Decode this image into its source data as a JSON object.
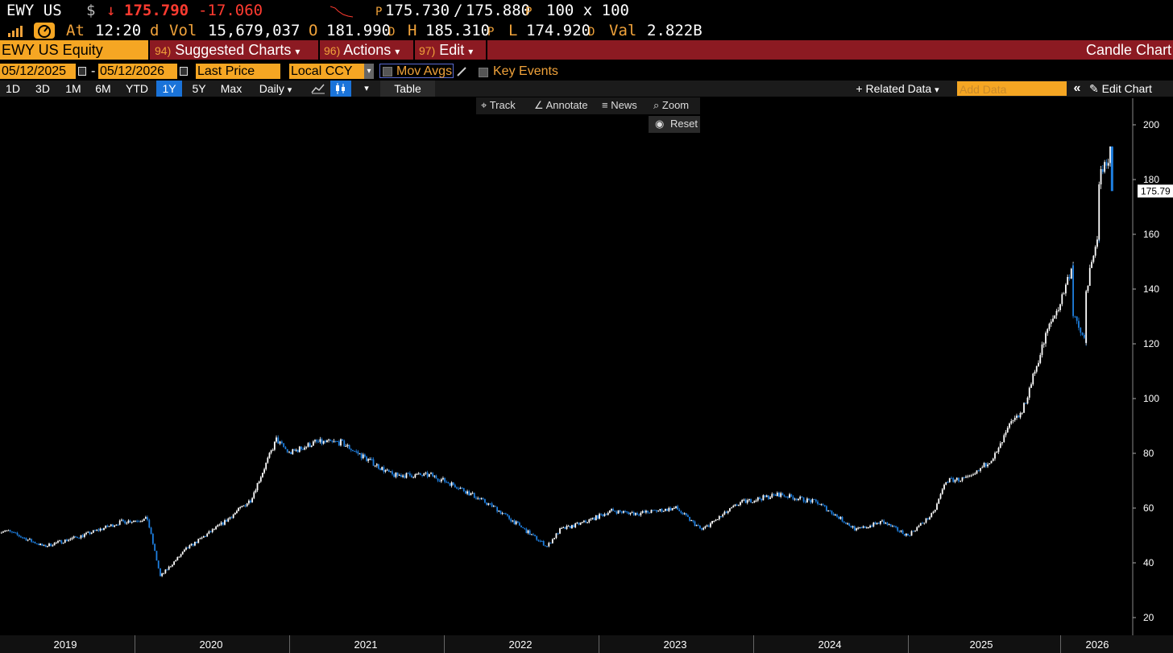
{
  "quote": {
    "ticker": "EWY US",
    "currency_symbol": "$",
    "arrow": "↓",
    "last": "175.790",
    "change": "-17.060",
    "bid_prefix": "P",
    "bid": "175.730",
    "slash": "/",
    "ask": "175.880",
    "ask_suffix": "P",
    "size": "100 x 100",
    "at_label": "At",
    "time": "12:20",
    "time_suffix": "d",
    "vol_label": "Vol",
    "vol": "15,679,037",
    "open_label": "O",
    "open": "181.990",
    "open_suffix": "D",
    "high_label": "H",
    "high": "185.310",
    "high_suffix": "P",
    "low_label": "L",
    "low": "174.920",
    "low_suffix": "D",
    "val_label": "Val",
    "val": "2.822B"
  },
  "menubar": {
    "security": "EWY US Equity",
    "suggested_num": "94)",
    "suggested": "Suggested Charts",
    "actions_num": "96)",
    "actions": "Actions",
    "edit_num": "97)",
    "edit": "Edit",
    "caret": "▾",
    "title": "Candle Chart"
  },
  "controls": {
    "start_date": "05/12/2025",
    "dash": "-",
    "end_date": "05/12/2026",
    "field": "Last Price",
    "currency": "Local CCY",
    "mov_avgs": "Mov Avgs",
    "key_events": "Key Events"
  },
  "periods": [
    "1D",
    "3D",
    "1M",
    "6M",
    "YTD",
    "1Y",
    "5Y",
    "Max"
  ],
  "selected_period": "1Y",
  "toolbar": {
    "frequency": "Daily",
    "table": "Table",
    "related_data": "Related Data",
    "add_data_placeholder": "Add Data",
    "double_chevron": "«",
    "edit_chart": "Edit Chart"
  },
  "chart_tools": {
    "track": "Track",
    "annotate": "Annotate",
    "news": "News",
    "zoom": "Zoom",
    "reset": "Reset"
  },
  "colors": {
    "menubar": "#8c1a22",
    "accent_orange": "#f5a623",
    "down_red": "#ff3b30",
    "candle_up": "#ffffff",
    "candle_down": "#1e7fe0",
    "selected_blue": "#1a73d9"
  },
  "chart_data": {
    "type": "line",
    "style": "candlestick",
    "series_color_up": "#ffffff",
    "series_color_down": "#1e7fe0",
    "ylim": [
      20,
      200
    ],
    "yticks": [
      20,
      40,
      60,
      80,
      100,
      120,
      140,
      160,
      180,
      200
    ],
    "last_price_label": "175.79",
    "xtick_labels": [
      "2019",
      "2020",
      "2021",
      "2022",
      "2023",
      "2024",
      "2025",
      "2026"
    ],
    "x": [
      "2018-06",
      "2018-09",
      "2018-12",
      "2019-03",
      "2019-06",
      "2019-09",
      "2019-12",
      "2020-02",
      "2020-03",
      "2020-05",
      "2020-08",
      "2020-10",
      "2020-12",
      "2021-01",
      "2021-03",
      "2021-05",
      "2021-07",
      "2021-09",
      "2021-12",
      "2022-02",
      "2022-05",
      "2022-07",
      "2022-09",
      "2022-10",
      "2022-12",
      "2023-02",
      "2023-04",
      "2023-07",
      "2023-09",
      "2023-12",
      "2024-03",
      "2024-06",
      "2024-09",
      "2024-11",
      "2025-01",
      "2025-03",
      "2025-04",
      "2025-06",
      "2025-08",
      "2025-09",
      "2025-10",
      "2025-11",
      "2025-12",
      "2026-01",
      "2026-02",
      "2026-02",
      "2026-03",
      "2026-03",
      "2026-04",
      "2026-04",
      "2026-05",
      "2026-05"
    ],
    "values": [
      55,
      54,
      49,
      52,
      46,
      50,
      55,
      56,
      35,
      45,
      55,
      63,
      85,
      80,
      84,
      84,
      78,
      72,
      72,
      68,
      60,
      53,
      46,
      52,
      55,
      59,
      58,
      60,
      52,
      62,
      65,
      62,
      52,
      55,
      50,
      58,
      70,
      71,
      80,
      90,
      95,
      110,
      125,
      135,
      150,
      130,
      120,
      140,
      160,
      180,
      192,
      175.79
    ]
  }
}
